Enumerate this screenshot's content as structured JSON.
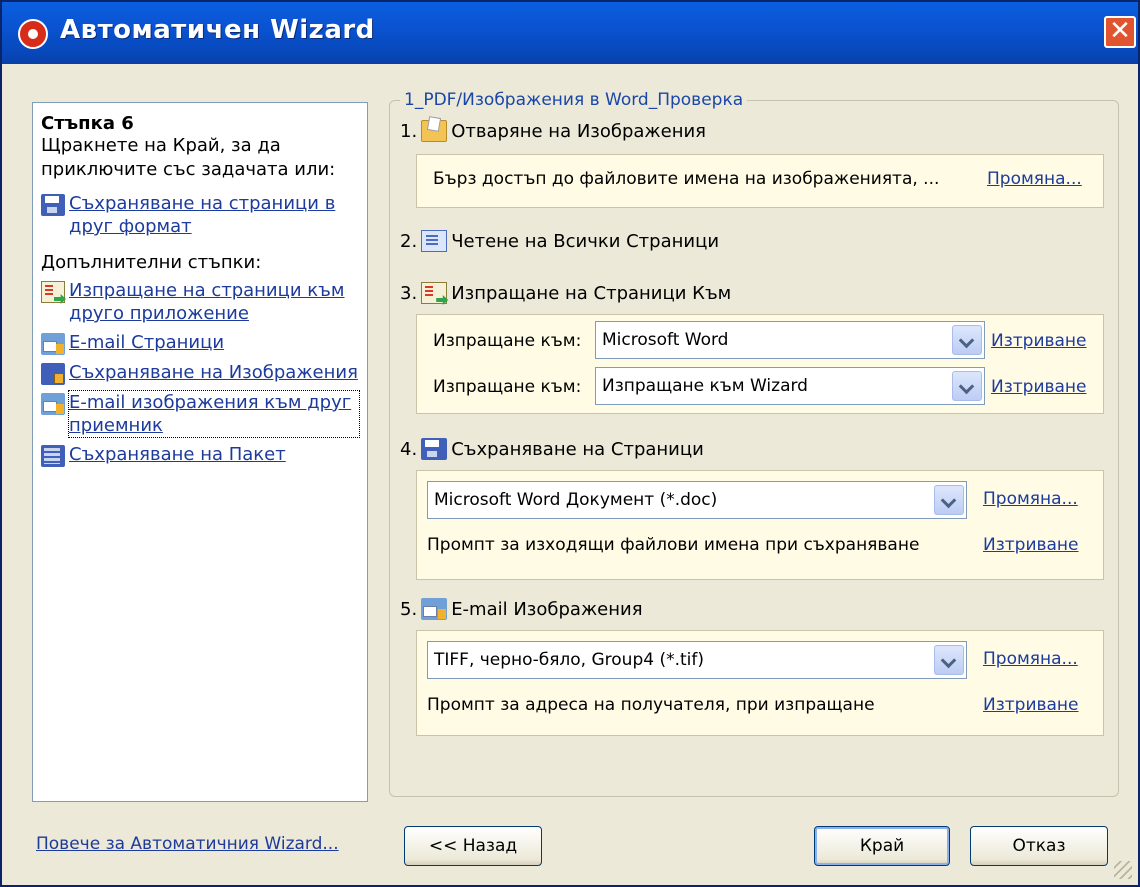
{
  "window": {
    "title": "Автоматичен Wizard",
    "close_glyph": "✕"
  },
  "sidebar": {
    "step_title": "Стъпка 6",
    "step_text": "Щракнете на Край, за да приключите със задачата или:",
    "save_link": "Съхраняване на страници в друг формат",
    "extra_title": "Допълнителни стъпки:",
    "links": [
      "Изпращане на страници към друго приложение",
      "E-mail Страници",
      "Съхраняване на Изображения",
      "E-mail изображения към друг приемник",
      "Съхраняване на Пакет"
    ]
  },
  "group": {
    "legend": "1_PDF/Изображения в Word_Проверка",
    "steps": [
      {
        "num": "1.",
        "title": "Отваряне на Изображения",
        "text": "Бърз достъп до файловите имена на изображенията, ...",
        "link": "Промяна..."
      },
      {
        "num": "2.",
        "title": "Четене на Всички Страници"
      },
      {
        "num": "3.",
        "title": "Изпращане на Страници Към",
        "rows": [
          {
            "label": "Изпращане към:",
            "value": "Microsoft Word",
            "link": "Изтриване"
          },
          {
            "label": "Изпращане към:",
            "value": "Изпращане към Wizard",
            "link": "Изтриване"
          }
        ]
      },
      {
        "num": "4.",
        "title": "Съхраняване на Страници",
        "select": "Microsoft Word Документ (*.doc)",
        "link": "Промяна...",
        "text": "Промпт за изходящи файлови имена при съхраняване",
        "link2": "Изтриване"
      },
      {
        "num": "5.",
        "title": "E-mail Изображения",
        "select": "TIFF, черно-бяло, Group4 (*.tif)",
        "link": "Промяна...",
        "text": "Промпт за адреса на получателя, при изпращане",
        "link2": "Изтриване"
      }
    ]
  },
  "footer": {
    "more_link": "Повече за Автоматичния Wizard...",
    "back_button": "<< Назад",
    "finish_button": "Край",
    "cancel_button": "Отказ"
  }
}
